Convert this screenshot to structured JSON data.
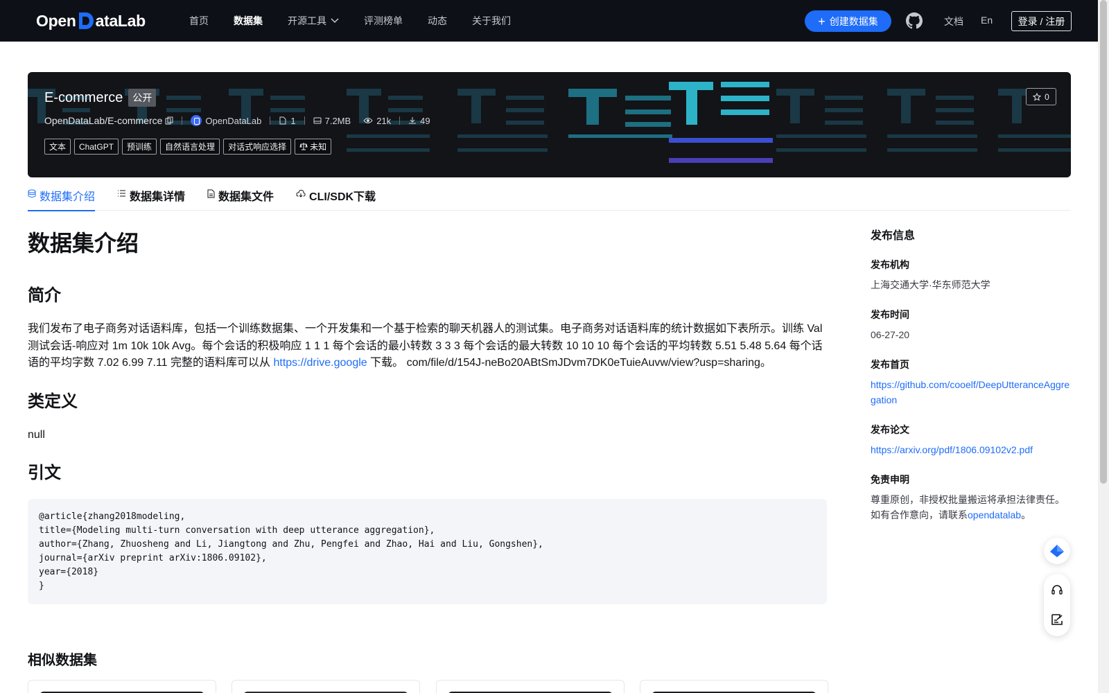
{
  "nav": {
    "logo_left": "Open",
    "logo_right": "ataLab",
    "links": [
      "首页",
      "数据集",
      "开源工具",
      "评测榜单",
      "动态",
      "关于我们"
    ],
    "create_label": "创建数据集",
    "doc_label": "文档",
    "lang_label": "En",
    "login_label": "登录 / 注册"
  },
  "dataset": {
    "title": "E-commerce",
    "visibility": "公开",
    "path": "OpenDataLab/E-commerce",
    "org": "OpenDataLab",
    "file_count": "1",
    "size": "7.2MB",
    "views": "21k",
    "downloads": "49",
    "tags": [
      "文本",
      "ChatGPT",
      "预训练",
      "自然语言处理",
      "对话式响应选择",
      "未知"
    ],
    "stars": "0"
  },
  "tabs": [
    "数据集介绍",
    "数据集详情",
    "数据集文件",
    "CLI/SDK下载"
  ],
  "content": {
    "heading": "数据集介绍",
    "intro_heading": "简介",
    "intro_text": "我们发布了电子商务对话语料库，包括一个训练数据集、一个开发集和一个基于检索的聊天机器人的测试集。电子商务对话语料库的统计数据如下表所示。训练 Val 测试会话-响应对 1m 10k 10k Avg。每个会话的积极响应 1 1 1 每个会话的最小转数 3 3 3 每个会话的最大转数 10 10 10 每个会话的平均转数 5.51 5.48 5.64 每个话语的平均字数 7.02 6.99 7.11 完整的语料库可以从 ",
    "intro_link": "https://drive.google",
    "intro_after": " 下载。 com/file/d/154J-neBo20ABtSmJDvm7DK0eTuieAuvw/view?usp=sharing。",
    "class_heading": "类定义",
    "class_text": "null",
    "cite_heading": "引文",
    "citation": "@article{zhang2018modeling,\ntitle={Modeling multi-turn conversation with deep utterance aggregation},\nauthor={Zhang, Zhuosheng and Li, Jiangtong and Zhu, Pengfei and Zhao, Hai and Liu, Gongshen},\njournal={arXiv preprint arXiv:1806.09102},\nyear={2018}\n}",
    "similar_heading": "相似数据集"
  },
  "sidebar": {
    "title": "发布信息",
    "org_label": "发布机构",
    "org_value": "上海交通大学·华东师范大学",
    "date_label": "发布时间",
    "date_value": "06-27-20",
    "home_label": "发布首页",
    "home_value": "https://github.com/cooelf/DeepUtteranceAggregation",
    "paper_label": "发布论文",
    "paper_value": "https://arxiv.org/pdf/1806.09102v2.pdf",
    "disclaimer_label": "免责申明",
    "disclaimer_text": "尊重原创，非授权批量搬运将承担法律责任。如有合作意向，请联系",
    "disclaimer_link": "opendatalab",
    "disclaimer_end": "。"
  },
  "colors": {
    "brand": "#1e6cf8",
    "nav_bg": "#0d1117",
    "banner_bg": "#121418"
  },
  "icons": [
    "chevron-down-icon",
    "plus-icon",
    "github-icon",
    "copy-icon",
    "file-icon",
    "disk-icon",
    "eye-icon",
    "download-icon",
    "scale-icon",
    "star-icon",
    "database-icon",
    "list-icon",
    "document-icon",
    "cloud-icon",
    "ship-icon",
    "headset-icon",
    "edit-icon"
  ]
}
